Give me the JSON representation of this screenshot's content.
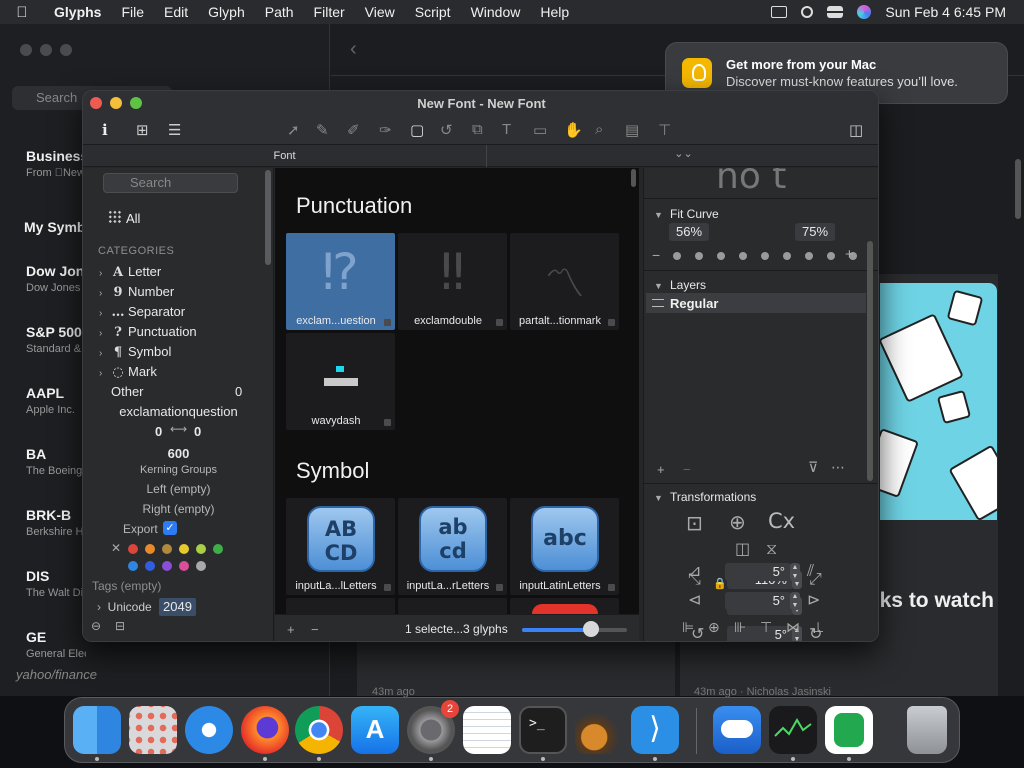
{
  "menubar": {
    "app": "Glyphs",
    "items": [
      "File",
      "Edit",
      "Glyph",
      "Path",
      "Filter",
      "View",
      "Script",
      "Window",
      "Help"
    ],
    "clock": "Sun Feb 4  6:45 PM"
  },
  "notification": {
    "title": "Get more from your Mac",
    "body": "Discover must-know features you’ll love."
  },
  "stocks": {
    "search_placeholder": "Search",
    "items": [
      {
        "title": "Business",
        "subtitle": "From News"
      },
      {
        "title": "My Symbols",
        "subtitle": ""
      },
      {
        "title": "Dow Jones",
        "subtitle": "Dow Jones"
      },
      {
        "title": "S&P 500",
        "subtitle": "Standard & Poor's"
      },
      {
        "title": "AAPL",
        "subtitle": "Apple Inc."
      },
      {
        "title": "BA",
        "subtitle": "The Boeing Company"
      },
      {
        "title": "BRK-B",
        "subtitle": "Berkshire Hathaway"
      },
      {
        "title": "DIS",
        "subtitle": "The Walt Disney"
      },
      {
        "title": "GE",
        "subtitle": "General Electric Compa"
      }
    ],
    "footer": "yahoo/finance",
    "headline": "y, PayPal, tocks to watch",
    "meta_left": "43m ago",
    "meta_right": "43m ago · Nicholas Jasinski"
  },
  "window": {
    "title": "New Font - New Font",
    "tab_font": "Font",
    "tab_right": "⌄⌄"
  },
  "sidebar": {
    "search_placeholder": "Search",
    "all": "All",
    "categories_label": "CATEGORIES",
    "categories": [
      {
        "glyph": "A",
        "label": "Letter"
      },
      {
        "glyph": "9",
        "label": "Number"
      },
      {
        "glyph": "…",
        "label": "Separator"
      },
      {
        "glyph": "?",
        "label": "Punctuation"
      },
      {
        "glyph": "¶",
        "label": "Symbol"
      },
      {
        "glyph": "◌",
        "label": "Mark"
      }
    ],
    "other_label": "Other",
    "other_count": "0",
    "glyph_name": "exclamationquestion",
    "lsb": "0",
    "rsb": "0",
    "width": "600",
    "kerning_groups": "Kerning Groups",
    "left_kern": "Left  (empty)",
    "right_kern": "Right  (empty)",
    "export_label": "Export",
    "export_check": "✓",
    "colors": [
      "#d9463e",
      "#e88a2c",
      "#b0893c",
      "#e7c92e",
      "#a8cf45",
      "#3fae49",
      "#2f86e0",
      "#2f5fe0",
      "#8a4fd6",
      "#d94f9a",
      "#a9a9a9"
    ],
    "tags": "Tags (empty)",
    "unicode_label": "Unicode",
    "unicode_value": "2049"
  },
  "grid": {
    "sections": [
      {
        "title": "Punctuation",
        "cells": [
          {
            "glyph": "⁉",
            "label": "exclam...uestion",
            "selected": true
          },
          {
            "glyph": "‼",
            "label": "exclamdouble",
            "selected": false
          },
          {
            "glyph": "〽",
            "label": "partalt...tionmark",
            "selected": false
          },
          {
            "glyph": "〰",
            "label": "wavydash",
            "selected": false
          }
        ]
      },
      {
        "title": "Symbol",
        "cells": [
          {
            "glyph": "ABCD",
            "label": "inputLa...lLetters"
          },
          {
            "glyph": "abcd",
            "label": "inputLa...rLetters"
          },
          {
            "glyph": "abc",
            "label": "inputLatinLetters"
          }
        ]
      }
    ],
    "footer_add": "+",
    "footer_remove": "−",
    "selection_status": "1 selecte...3 glyphs",
    "zoom_fraction": 0.66
  },
  "inspector": {
    "preview_text": "no  t",
    "fit_curve_label": "Fit Curve",
    "fit_min": "56%",
    "fit_max": "75%",
    "fit_minus": "−",
    "fit_plus": "+",
    "layers_label": "Layers",
    "layer_name": "Regular",
    "layers_add": "+",
    "layers_remove": "−",
    "transformations_label": "Transformations",
    "cx_label": "Cx",
    "scale_x": "110%",
    "scale_y": "110%",
    "rotate": "5°",
    "slant_x": "5°",
    "slant_y": "5°"
  },
  "dock": {
    "apps": [
      "Finder",
      "Launchpad",
      "Safari",
      "Firefox",
      "Chrome",
      "App Store",
      "System Settings",
      "TextEdit",
      "Terminal",
      "GarageBand",
      "VS Code",
      "Weather",
      "Stocks",
      "Evernote",
      "Trash"
    ],
    "settings_badge": "2"
  }
}
